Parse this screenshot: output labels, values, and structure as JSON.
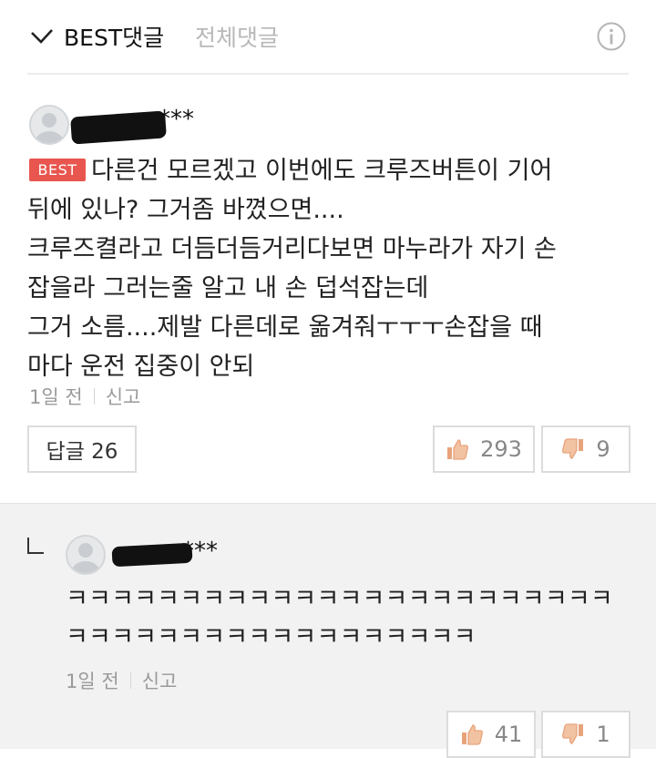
{
  "tabs": {
    "best_label": "BEST댓글",
    "all_label": "전체댓글"
  },
  "comment": {
    "username_suffix": "***",
    "badge": "BEST",
    "lines": [
      "다른건 모르겠고 이번에도 크루즈버튼이 기어",
      "뒤에 있나? 그거좀 바꼈으면....",
      "크루즈켤라고 더듬더듬거리다보면 마누라가 자기 손",
      "잡을라 그러는줄 알고 내 손 덥석잡는데",
      "그거 소름....제발 다른데로 옮겨줘ㅜㅜㅜ손잡을 때",
      "마다 운전 집중이 안되"
    ],
    "time": "1일 전",
    "report_label": "신고",
    "reply_button": "답글 26",
    "likes": "293",
    "dislikes": "9"
  },
  "reply": {
    "username_suffix": "***",
    "lines": [
      "ㅋㅋㅋㅋㅋㅋㅋㅋㅋㅋㅋㅋㅋㅋㅋㅋㅋㅋㅋㅋㅋㅋㅋㅋ",
      "ㅋㅋㅋㅋㅋㅋㅋㅋㅋㅋㅋㅋㅋㅋㅋㅋㅋㅋ"
    ],
    "time": "1일 전",
    "report_label": "신고",
    "likes": "41",
    "dislikes": "1"
  },
  "icons": {
    "check": "check-icon",
    "info": "info-icon",
    "thumbs_up": "thumbs-up-icon",
    "thumbs_down": "thumbs-down-icon",
    "reply_arrow": "reply-arrow-icon"
  },
  "colors": {
    "badge": "#e8564f",
    "vote_icon": "#e8a37b",
    "inactive_tab": "#b8b8b8"
  }
}
